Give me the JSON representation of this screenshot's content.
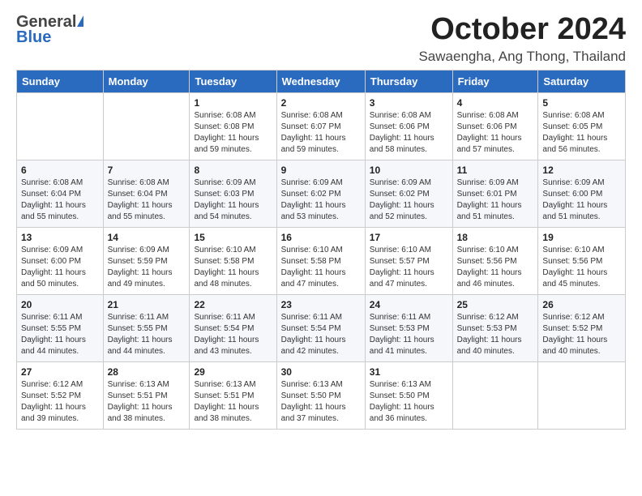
{
  "logo": {
    "general": "General",
    "blue": "Blue"
  },
  "title": {
    "month_year": "October 2024",
    "location": "Sawaengha, Ang Thong, Thailand"
  },
  "weekdays": [
    "Sunday",
    "Monday",
    "Tuesday",
    "Wednesday",
    "Thursday",
    "Friday",
    "Saturday"
  ],
  "weeks": [
    [
      {
        "day": "",
        "sunrise": "",
        "sunset": "",
        "daylight": ""
      },
      {
        "day": "",
        "sunrise": "",
        "sunset": "",
        "daylight": ""
      },
      {
        "day": "1",
        "sunrise": "Sunrise: 6:08 AM",
        "sunset": "Sunset: 6:08 PM",
        "daylight": "Daylight: 11 hours and 59 minutes."
      },
      {
        "day": "2",
        "sunrise": "Sunrise: 6:08 AM",
        "sunset": "Sunset: 6:07 PM",
        "daylight": "Daylight: 11 hours and 59 minutes."
      },
      {
        "day": "3",
        "sunrise": "Sunrise: 6:08 AM",
        "sunset": "Sunset: 6:06 PM",
        "daylight": "Daylight: 11 hours and 58 minutes."
      },
      {
        "day": "4",
        "sunrise": "Sunrise: 6:08 AM",
        "sunset": "Sunset: 6:06 PM",
        "daylight": "Daylight: 11 hours and 57 minutes."
      },
      {
        "day": "5",
        "sunrise": "Sunrise: 6:08 AM",
        "sunset": "Sunset: 6:05 PM",
        "daylight": "Daylight: 11 hours and 56 minutes."
      }
    ],
    [
      {
        "day": "6",
        "sunrise": "Sunrise: 6:08 AM",
        "sunset": "Sunset: 6:04 PM",
        "daylight": "Daylight: 11 hours and 55 minutes."
      },
      {
        "day": "7",
        "sunrise": "Sunrise: 6:08 AM",
        "sunset": "Sunset: 6:04 PM",
        "daylight": "Daylight: 11 hours and 55 minutes."
      },
      {
        "day": "8",
        "sunrise": "Sunrise: 6:09 AM",
        "sunset": "Sunset: 6:03 PM",
        "daylight": "Daylight: 11 hours and 54 minutes."
      },
      {
        "day": "9",
        "sunrise": "Sunrise: 6:09 AM",
        "sunset": "Sunset: 6:02 PM",
        "daylight": "Daylight: 11 hours and 53 minutes."
      },
      {
        "day": "10",
        "sunrise": "Sunrise: 6:09 AM",
        "sunset": "Sunset: 6:02 PM",
        "daylight": "Daylight: 11 hours and 52 minutes."
      },
      {
        "day": "11",
        "sunrise": "Sunrise: 6:09 AM",
        "sunset": "Sunset: 6:01 PM",
        "daylight": "Daylight: 11 hours and 51 minutes."
      },
      {
        "day": "12",
        "sunrise": "Sunrise: 6:09 AM",
        "sunset": "Sunset: 6:00 PM",
        "daylight": "Daylight: 11 hours and 51 minutes."
      }
    ],
    [
      {
        "day": "13",
        "sunrise": "Sunrise: 6:09 AM",
        "sunset": "Sunset: 6:00 PM",
        "daylight": "Daylight: 11 hours and 50 minutes."
      },
      {
        "day": "14",
        "sunrise": "Sunrise: 6:09 AM",
        "sunset": "Sunset: 5:59 PM",
        "daylight": "Daylight: 11 hours and 49 minutes."
      },
      {
        "day": "15",
        "sunrise": "Sunrise: 6:10 AM",
        "sunset": "Sunset: 5:58 PM",
        "daylight": "Daylight: 11 hours and 48 minutes."
      },
      {
        "day": "16",
        "sunrise": "Sunrise: 6:10 AM",
        "sunset": "Sunset: 5:58 PM",
        "daylight": "Daylight: 11 hours and 47 minutes."
      },
      {
        "day": "17",
        "sunrise": "Sunrise: 6:10 AM",
        "sunset": "Sunset: 5:57 PM",
        "daylight": "Daylight: 11 hours and 47 minutes."
      },
      {
        "day": "18",
        "sunrise": "Sunrise: 6:10 AM",
        "sunset": "Sunset: 5:56 PM",
        "daylight": "Daylight: 11 hours and 46 minutes."
      },
      {
        "day": "19",
        "sunrise": "Sunrise: 6:10 AM",
        "sunset": "Sunset: 5:56 PM",
        "daylight": "Daylight: 11 hours and 45 minutes."
      }
    ],
    [
      {
        "day": "20",
        "sunrise": "Sunrise: 6:11 AM",
        "sunset": "Sunset: 5:55 PM",
        "daylight": "Daylight: 11 hours and 44 minutes."
      },
      {
        "day": "21",
        "sunrise": "Sunrise: 6:11 AM",
        "sunset": "Sunset: 5:55 PM",
        "daylight": "Daylight: 11 hours and 44 minutes."
      },
      {
        "day": "22",
        "sunrise": "Sunrise: 6:11 AM",
        "sunset": "Sunset: 5:54 PM",
        "daylight": "Daylight: 11 hours and 43 minutes."
      },
      {
        "day": "23",
        "sunrise": "Sunrise: 6:11 AM",
        "sunset": "Sunset: 5:54 PM",
        "daylight": "Daylight: 11 hours and 42 minutes."
      },
      {
        "day": "24",
        "sunrise": "Sunrise: 6:11 AM",
        "sunset": "Sunset: 5:53 PM",
        "daylight": "Daylight: 11 hours and 41 minutes."
      },
      {
        "day": "25",
        "sunrise": "Sunrise: 6:12 AM",
        "sunset": "Sunset: 5:53 PM",
        "daylight": "Daylight: 11 hours and 40 minutes."
      },
      {
        "day": "26",
        "sunrise": "Sunrise: 6:12 AM",
        "sunset": "Sunset: 5:52 PM",
        "daylight": "Daylight: 11 hours and 40 minutes."
      }
    ],
    [
      {
        "day": "27",
        "sunrise": "Sunrise: 6:12 AM",
        "sunset": "Sunset: 5:52 PM",
        "daylight": "Daylight: 11 hours and 39 minutes."
      },
      {
        "day": "28",
        "sunrise": "Sunrise: 6:13 AM",
        "sunset": "Sunset: 5:51 PM",
        "daylight": "Daylight: 11 hours and 38 minutes."
      },
      {
        "day": "29",
        "sunrise": "Sunrise: 6:13 AM",
        "sunset": "Sunset: 5:51 PM",
        "daylight": "Daylight: 11 hours and 38 minutes."
      },
      {
        "day": "30",
        "sunrise": "Sunrise: 6:13 AM",
        "sunset": "Sunset: 5:50 PM",
        "daylight": "Daylight: 11 hours and 37 minutes."
      },
      {
        "day": "31",
        "sunrise": "Sunrise: 6:13 AM",
        "sunset": "Sunset: 5:50 PM",
        "daylight": "Daylight: 11 hours and 36 minutes."
      },
      {
        "day": "",
        "sunrise": "",
        "sunset": "",
        "daylight": ""
      },
      {
        "day": "",
        "sunrise": "",
        "sunset": "",
        "daylight": ""
      }
    ]
  ]
}
